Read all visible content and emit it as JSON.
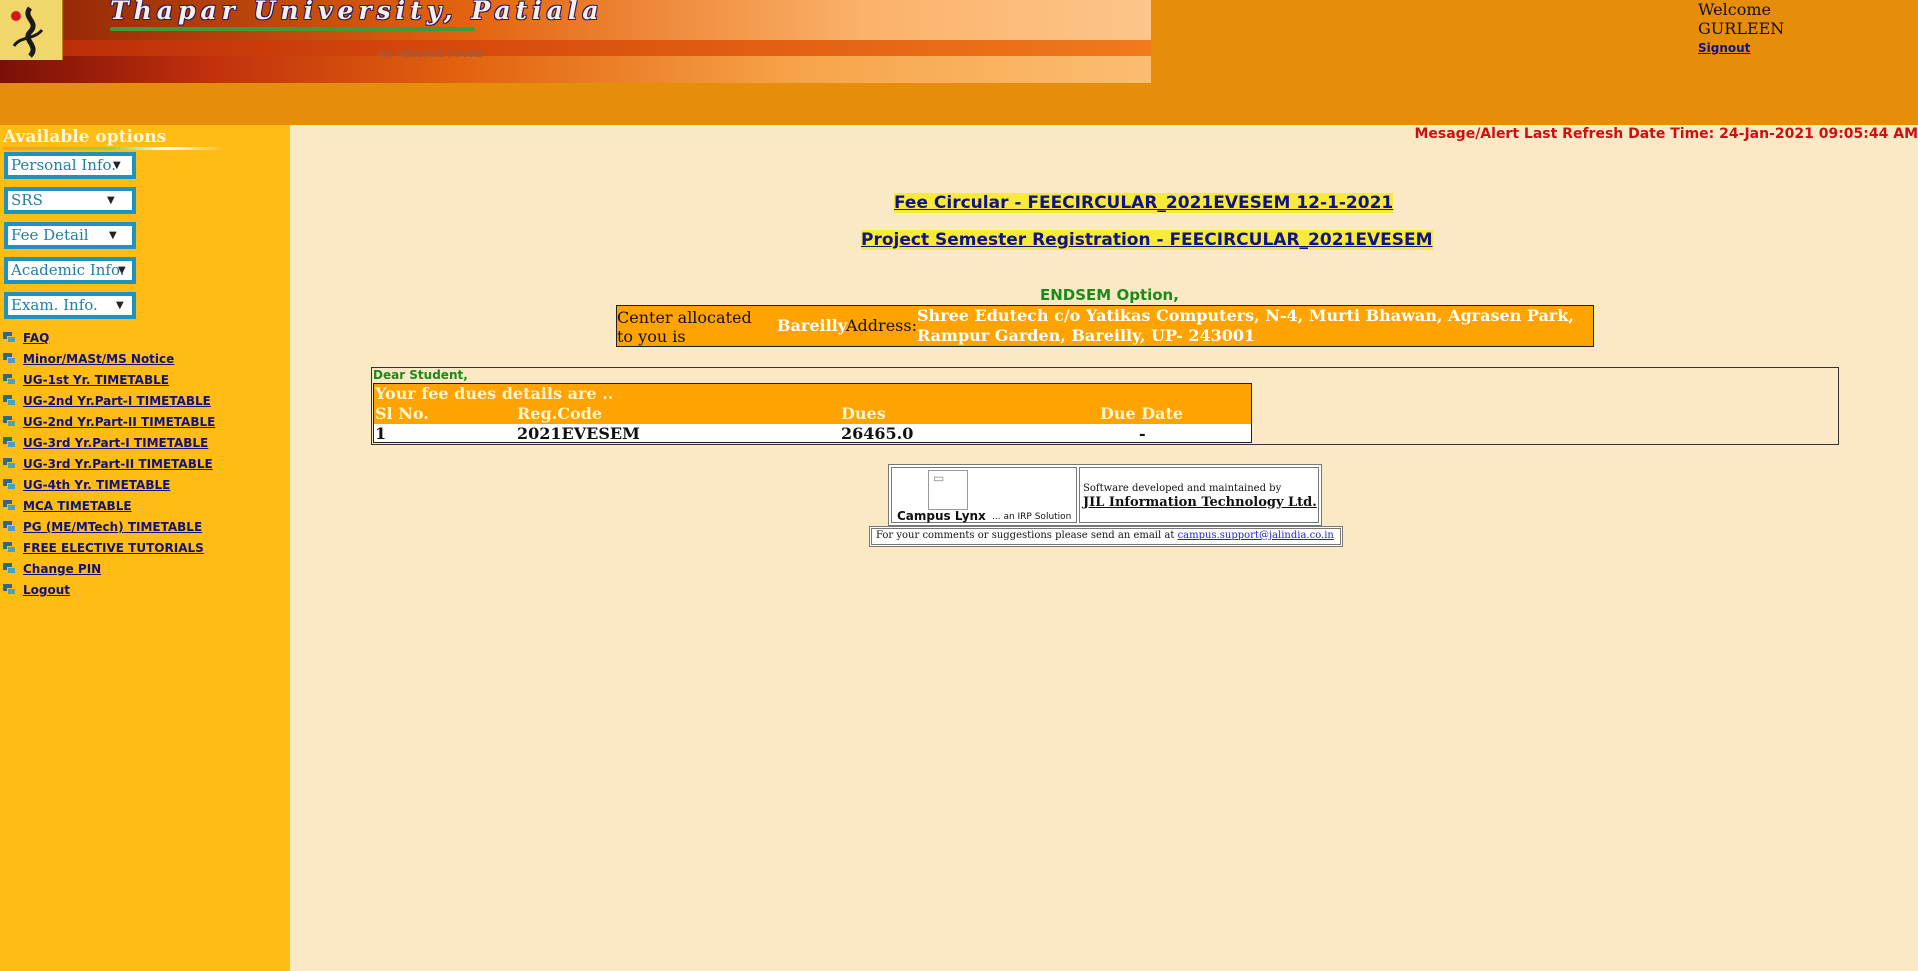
{
  "header": {
    "university_name": "Thapar University, Patiala",
    "no_message": "NO MESSAGE FOUND",
    "welcome": "Welcome",
    "username": "GURLEEN",
    "signout": "Signout"
  },
  "sidebar": {
    "title": "Available options",
    "menus": [
      "Personal Info.",
      "SRS",
      "Fee Detail",
      "Academic Info.",
      "Exam. Info."
    ],
    "links": [
      "FAQ",
      "Minor/MASt/MS Notice",
      "UG-1st Yr. TIMETABLE",
      "UG-2nd Yr.Part-I TIMETABLE",
      "UG-2nd Yr.Part-II TIMETABLE",
      "UG-3rd Yr.Part-I TIMETABLE",
      "UG-3rd Yr.Part-II TIMETABLE",
      "UG-4th Yr. TIMETABLE",
      "MCA TIMETABLE",
      "PG (ME/MTech) TIMETABLE",
      "FREE ELECTIVE TUTORIALS",
      "Change PIN",
      "Logout"
    ]
  },
  "main": {
    "alert": "Mesage/Alert Last Refresh Date Time: 24-Jan-2021 09:05:44 AM",
    "circulars": [
      "Fee Circular - FEECIRCULAR_2021EVESEM 12-1-2021",
      "Project Semester Registration - FEECIRCULAR_2021EVESEM"
    ],
    "endsem_option": "ENDSEM Option,",
    "center": {
      "label": "Center allocated to you is",
      "city": "Bareilly",
      "address_label": "Address:",
      "address": "Shree Edutech c/o Yatikas Computers, N-4, Murti Bhawan, Agrasen Park, Rampur Garden, Bareilly, UP- 243001"
    },
    "dear_student": "Dear Student,",
    "fee": {
      "title": "Your fee dues details are ..",
      "headers": [
        "Sl No.",
        "Reg.Code",
        "Dues",
        "Due Date"
      ],
      "row": [
        "1",
        "2021EVESEM",
        "26465.0",
        "-"
      ]
    }
  },
  "footer": {
    "product": "Campus Lynx",
    "tagline": "... an IRP Solution",
    "dev_text": "Software developed and maintained by",
    "company": "JIL Information Technology Ltd.",
    "mail_text": "For your comments or suggestions please send an email at ",
    "email": " campus.support@jalindia.co.in"
  },
  "colors": {
    "header": "#e68d0c",
    "sidebar": "#ffbc15",
    "content": "#fbe9c6",
    "table_header": "#ffa300",
    "alert": "#cc1111",
    "link": "#111177"
  },
  "icons": {
    "logo": "university-logo-icon",
    "menu_caret": "chevron-down-icon",
    "link_bullet": "bullet-icon",
    "footer_image": "broken-image-icon"
  }
}
